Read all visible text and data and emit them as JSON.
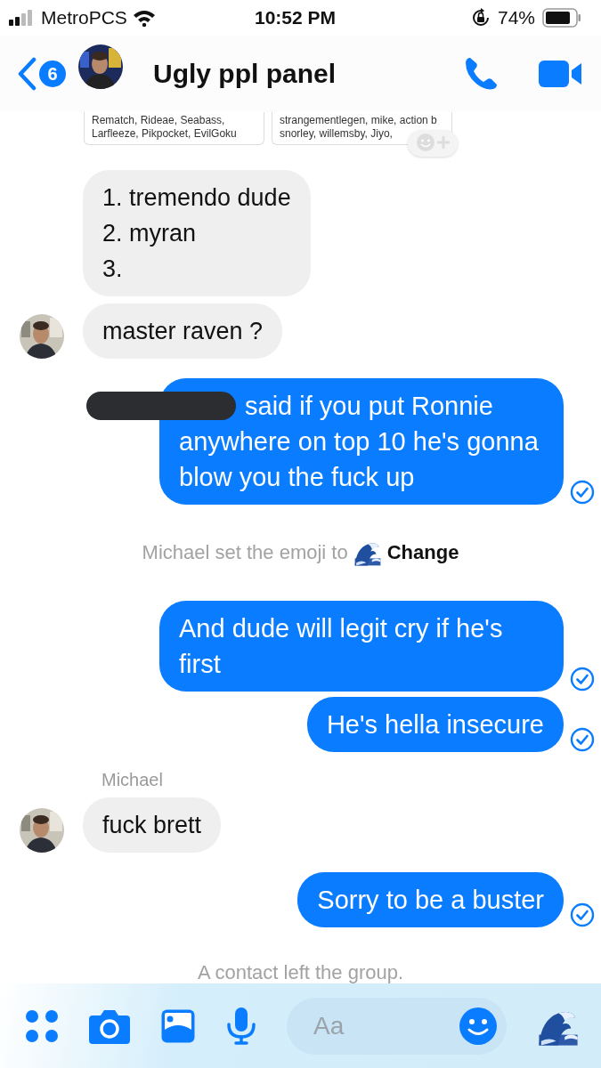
{
  "status_bar": {
    "carrier": "MetroPCS",
    "time": "10:52 PM",
    "battery": "74%"
  },
  "header": {
    "back_badge": "6",
    "title": "Ugly ppl panel"
  },
  "shared_cards": [
    {
      "lines": [
        "Rematch, Rideae, Seabass,",
        "Larfleeze, Pikpocket, EvilGoku"
      ]
    },
    {
      "lines": [
        "strangementlegen, mike, action b",
        "snorley, willemsby, Jiyo,"
      ]
    }
  ],
  "messages": [
    {
      "kind": "incoming",
      "avatar": false,
      "text": "1. tremendo dude\n2. myran\n3."
    },
    {
      "kind": "incoming",
      "avatar": true,
      "text": "master raven ?"
    },
    {
      "kind": "outgoing",
      "redacted": true,
      "delivered": true,
      "text": "said if you put Ronnie anywhere on top 10 he's gonna blow you the fuck up"
    },
    {
      "kind": "system",
      "text": "Michael set the emoji to",
      "action": "Change"
    },
    {
      "kind": "outgoing",
      "redacted": false,
      "delivered": true,
      "text": "And dude will legit cry if he's first"
    },
    {
      "kind": "outgoing",
      "redacted": false,
      "delivered": true,
      "text": "He's hella insecure"
    },
    {
      "kind": "sender",
      "text": "Michael"
    },
    {
      "kind": "incoming",
      "avatar": true,
      "text": "fuck brett"
    },
    {
      "kind": "outgoing",
      "redacted": false,
      "delivered": true,
      "text": "Sorry to be a buster"
    },
    {
      "kind": "system",
      "text": "A contact left the group."
    }
  ],
  "composer": {
    "placeholder": "Aa"
  }
}
